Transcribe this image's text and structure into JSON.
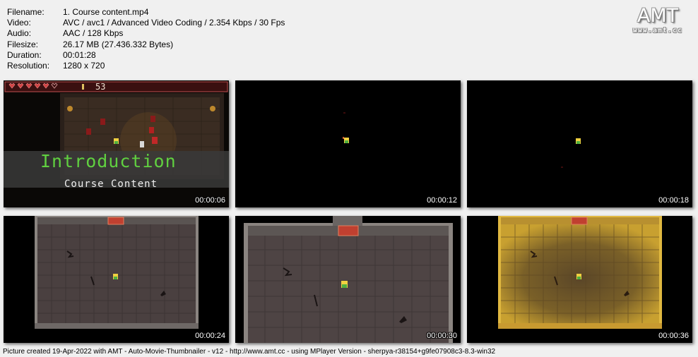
{
  "file_info": {
    "rows": [
      {
        "label": "Filename:",
        "value": "1. Course content.mp4"
      },
      {
        "label": "Video:",
        "value": "AVC / avc1 / Advanced Video Coding / 2.354 Kbps / 30 Fps"
      },
      {
        "label": "Audio:",
        "value": "AAC / 128 Kbps"
      },
      {
        "label": "Filesize:",
        "value": "26.17 MB (27.436.332 Bytes)"
      },
      {
        "label": "Duration:",
        "value": "00:01:28"
      },
      {
        "label": "Resolution:",
        "value": "1280 x 720"
      }
    ]
  },
  "logo": {
    "name": "AMT",
    "url": "www.amt.cc"
  },
  "thumbnails": [
    {
      "time": "00:00:06",
      "title": "Introduction",
      "subtitle": "Course Content",
      "ammo": "53"
    },
    {
      "time": "00:00:12"
    },
    {
      "time": "00:00:18"
    },
    {
      "time": "00:00:24"
    },
    {
      "time": "00:00:30"
    },
    {
      "time": "00:00:36"
    }
  ],
  "footer": "Picture created 19-Apr-2022 with AMT - Auto-Movie-Thumbnailer - v12 - http://www.amt.cc - using MPlayer Version - sherpya-r38154+g9fe07908c3-8.3-win32"
}
